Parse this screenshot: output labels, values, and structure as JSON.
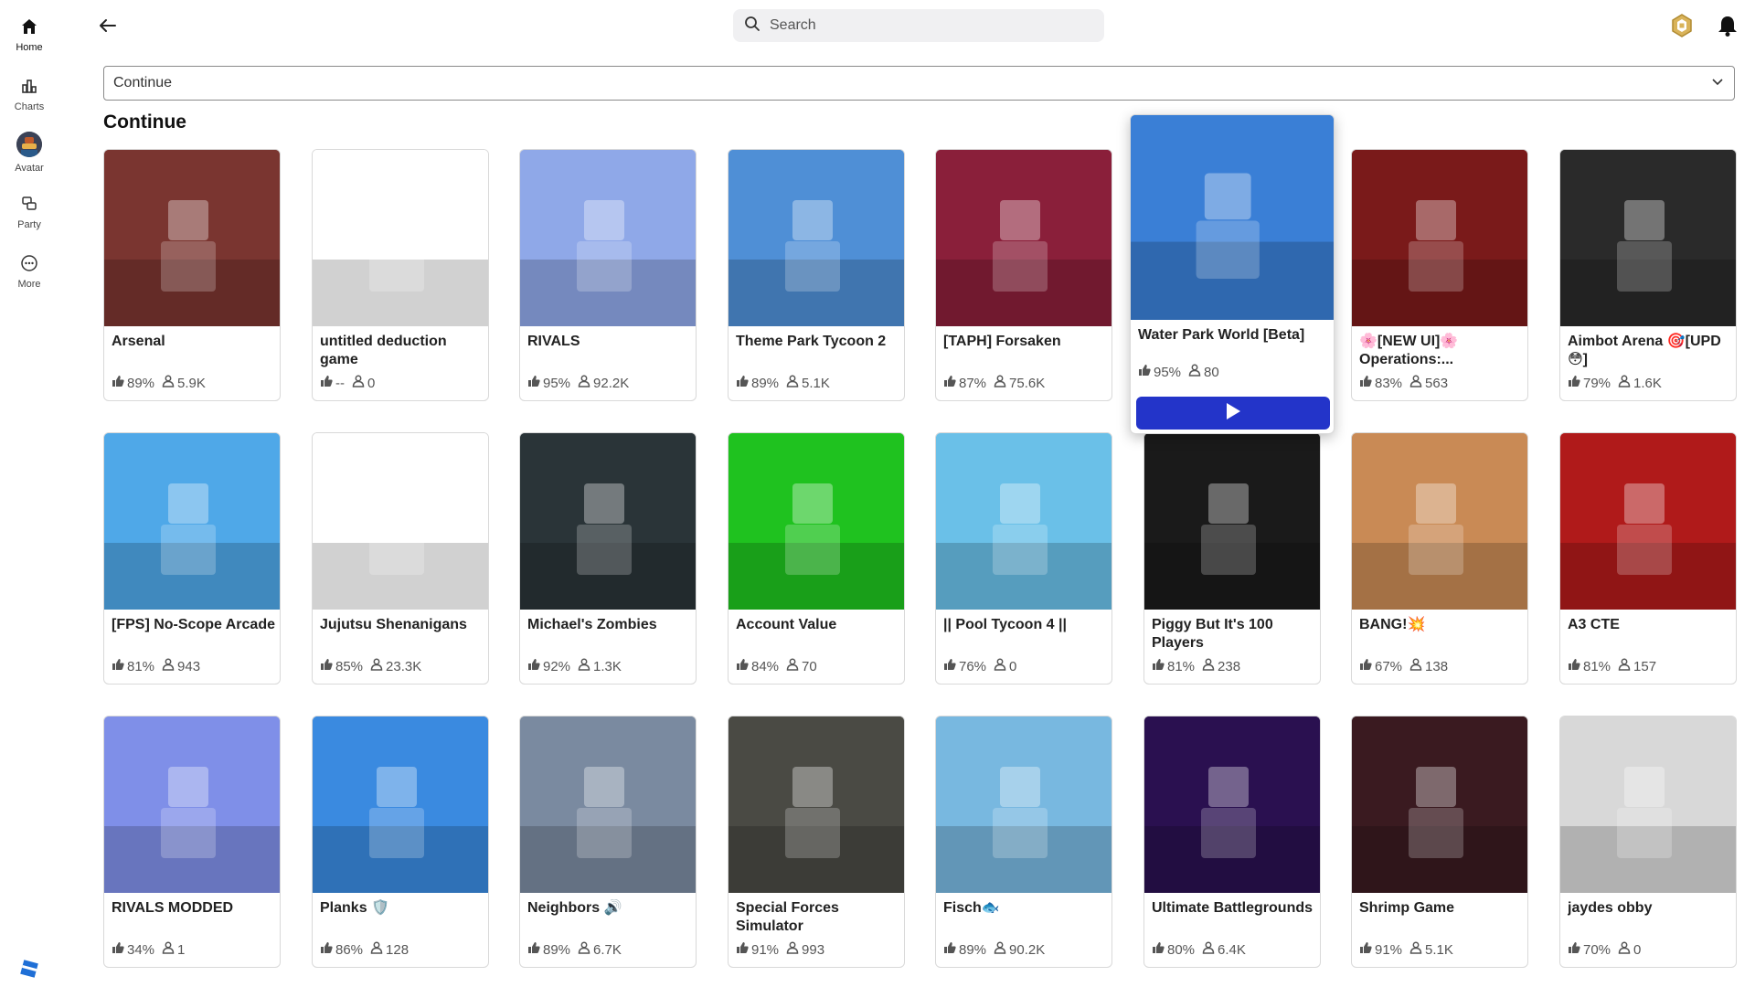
{
  "nav": {
    "items": [
      {
        "label": "Home",
        "icon": "home-icon"
      },
      {
        "label": "Charts",
        "icon": "charts-icon"
      },
      {
        "label": "Avatar",
        "icon": "avatar-icon"
      },
      {
        "label": "Party",
        "icon": "party-icon"
      },
      {
        "label": "More",
        "icon": "more-icon"
      }
    ]
  },
  "search": {
    "placeholder": "Search"
  },
  "filter": {
    "value": "Continue"
  },
  "section": {
    "title": "Continue"
  },
  "colors": {
    "play": "#2334c9",
    "accent": "#111111"
  },
  "games": [
    {
      "name": "Arsenal",
      "rating": "89%",
      "players": "5.9K",
      "bg": "#7a3530"
    },
    {
      "name": "untitled deduction game",
      "rating": "--",
      "players": "0",
      "bg": "#ffffff"
    },
    {
      "name": "RIVALS",
      "rating": "95%",
      "players": "92.2K",
      "bg": "#8fa8e8"
    },
    {
      "name": "Theme Park Tycoon 2",
      "rating": "89%",
      "players": "5.1K",
      "bg": "#4f8fd6"
    },
    {
      "name": "[TAPH] Forsaken",
      "rating": "87%",
      "players": "75.6K",
      "bg": "#8a1f3a"
    },
    {
      "name": "Water Park World [Beta]",
      "rating": "95%",
      "players": "80",
      "bg": "#3a7fd6"
    },
    {
      "name": "🌸[NEW UI]🌸Operations:...",
      "rating": "83%",
      "players": "563",
      "bg": "#7a1a1a"
    },
    {
      "name": "Aimbot Arena 🎯[UPD😳]",
      "rating": "79%",
      "players": "1.6K",
      "bg": "#2a2a2a"
    },
    {
      "name": "[FPS] No-Scope Arcade",
      "rating": "81%",
      "players": "943",
      "bg": "#4fa8e8"
    },
    {
      "name": "Jujutsu Shenanigans",
      "rating": "85%",
      "players": "23.3K",
      "bg": "#ffffff"
    },
    {
      "name": "Michael's Zombies",
      "rating": "92%",
      "players": "1.3K",
      "bg": "#2a3438"
    },
    {
      "name": "Account Value",
      "rating": "84%",
      "players": "70",
      "bg": "#1fc21f"
    },
    {
      "name": "|| Pool Tycoon 4 ||",
      "rating": "76%",
      "players": "0",
      "bg": "#6ac0e8"
    },
    {
      "name": "Piggy But It's 100 Players",
      "rating": "81%",
      "players": "238",
      "bg": "#1a1a1a"
    },
    {
      "name": "BANG!💥",
      "rating": "67%",
      "players": "138",
      "bg": "#c98a55"
    },
    {
      "name": "A3 CTE",
      "rating": "81%",
      "players": "157",
      "bg": "#b01a1a"
    },
    {
      "name": "RIVALS MODDED",
      "rating": "34%",
      "players": "1",
      "bg": "#7f8fe8"
    },
    {
      "name": "Planks 🛡️",
      "rating": "86%",
      "players": "128",
      "bg": "#3a8ae0"
    },
    {
      "name": "Neighbors 🔊",
      "rating": "89%",
      "players": "6.7K",
      "bg": "#7a8aa0"
    },
    {
      "name": "Special Forces Simulator",
      "rating": "91%",
      "players": "993",
      "bg": "#4a4a44"
    },
    {
      "name": "Fisch🐟",
      "rating": "89%",
      "players": "90.2K",
      "bg": "#78b8e0"
    },
    {
      "name": "Ultimate Battlegrounds",
      "rating": "80%",
      "players": "6.4K",
      "bg": "#2a1050"
    },
    {
      "name": "Shrimp Game",
      "rating": "91%",
      "players": "5.1K",
      "bg": "#3a1a20"
    },
    {
      "name": "jaydes obby",
      "rating": "70%",
      "players": "0",
      "bg": "#d8d8d8"
    }
  ]
}
